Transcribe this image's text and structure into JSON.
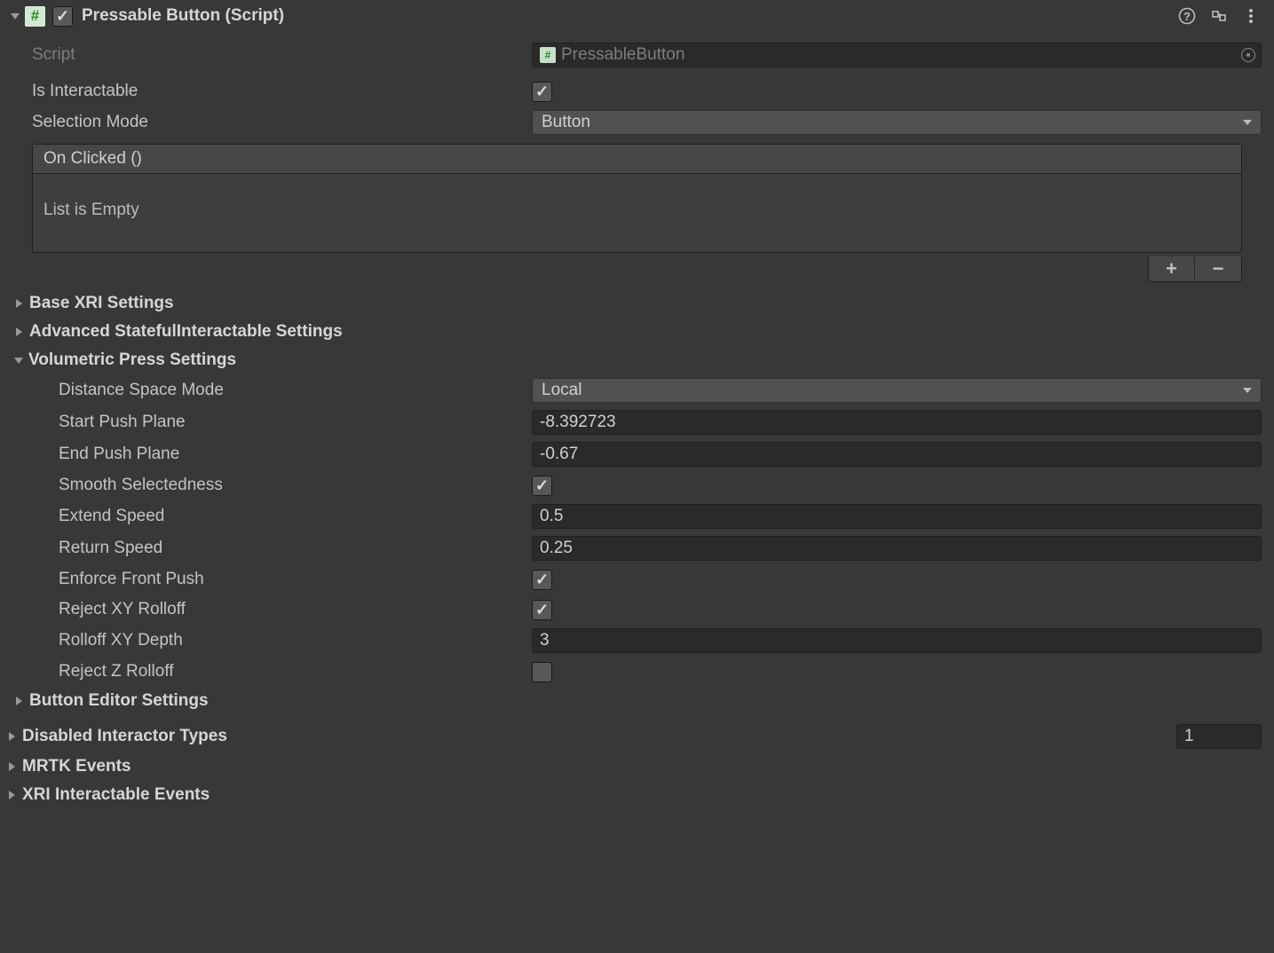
{
  "header": {
    "title": "Pressable Button (Script)"
  },
  "script": {
    "label": "Script",
    "value": "PressableButton"
  },
  "is_interactable": {
    "label": "Is Interactable",
    "checked": true
  },
  "selection_mode": {
    "label": "Selection Mode",
    "value": "Button"
  },
  "on_clicked": {
    "title": "On Clicked ()",
    "empty_text": "List is Empty"
  },
  "foldouts": {
    "base_xri": "Base XRI Settings",
    "advanced_stateful": "Advanced StatefulInteractable Settings",
    "volumetric": "Volumetric Press Settings",
    "button_editor": "Button Editor Settings",
    "disabled_interactors": {
      "label": "Disabled Interactor Types",
      "count": "1"
    },
    "mrtk_events": "MRTK Events",
    "xri_events": "XRI Interactable Events"
  },
  "volumetric": {
    "distance_space_mode": {
      "label": "Distance Space Mode",
      "value": "Local"
    },
    "start_push_plane": {
      "label": "Start Push Plane",
      "value": "-8.392723"
    },
    "end_push_plane": {
      "label": "End Push Plane",
      "value": "-0.67"
    },
    "smooth_selectedness": {
      "label": "Smooth Selectedness",
      "checked": true
    },
    "extend_speed": {
      "label": "Extend Speed",
      "value": "0.5"
    },
    "return_speed": {
      "label": "Return Speed",
      "value": "0.25"
    },
    "enforce_front_push": {
      "label": "Enforce Front Push",
      "checked": true
    },
    "reject_xy_rolloff": {
      "label": "Reject XY Rolloff",
      "checked": true
    },
    "rolloff_xy_depth": {
      "label": "Rolloff XY Depth",
      "value": "3"
    },
    "reject_z_rolloff": {
      "label": "Reject Z Rolloff",
      "checked": false
    }
  }
}
